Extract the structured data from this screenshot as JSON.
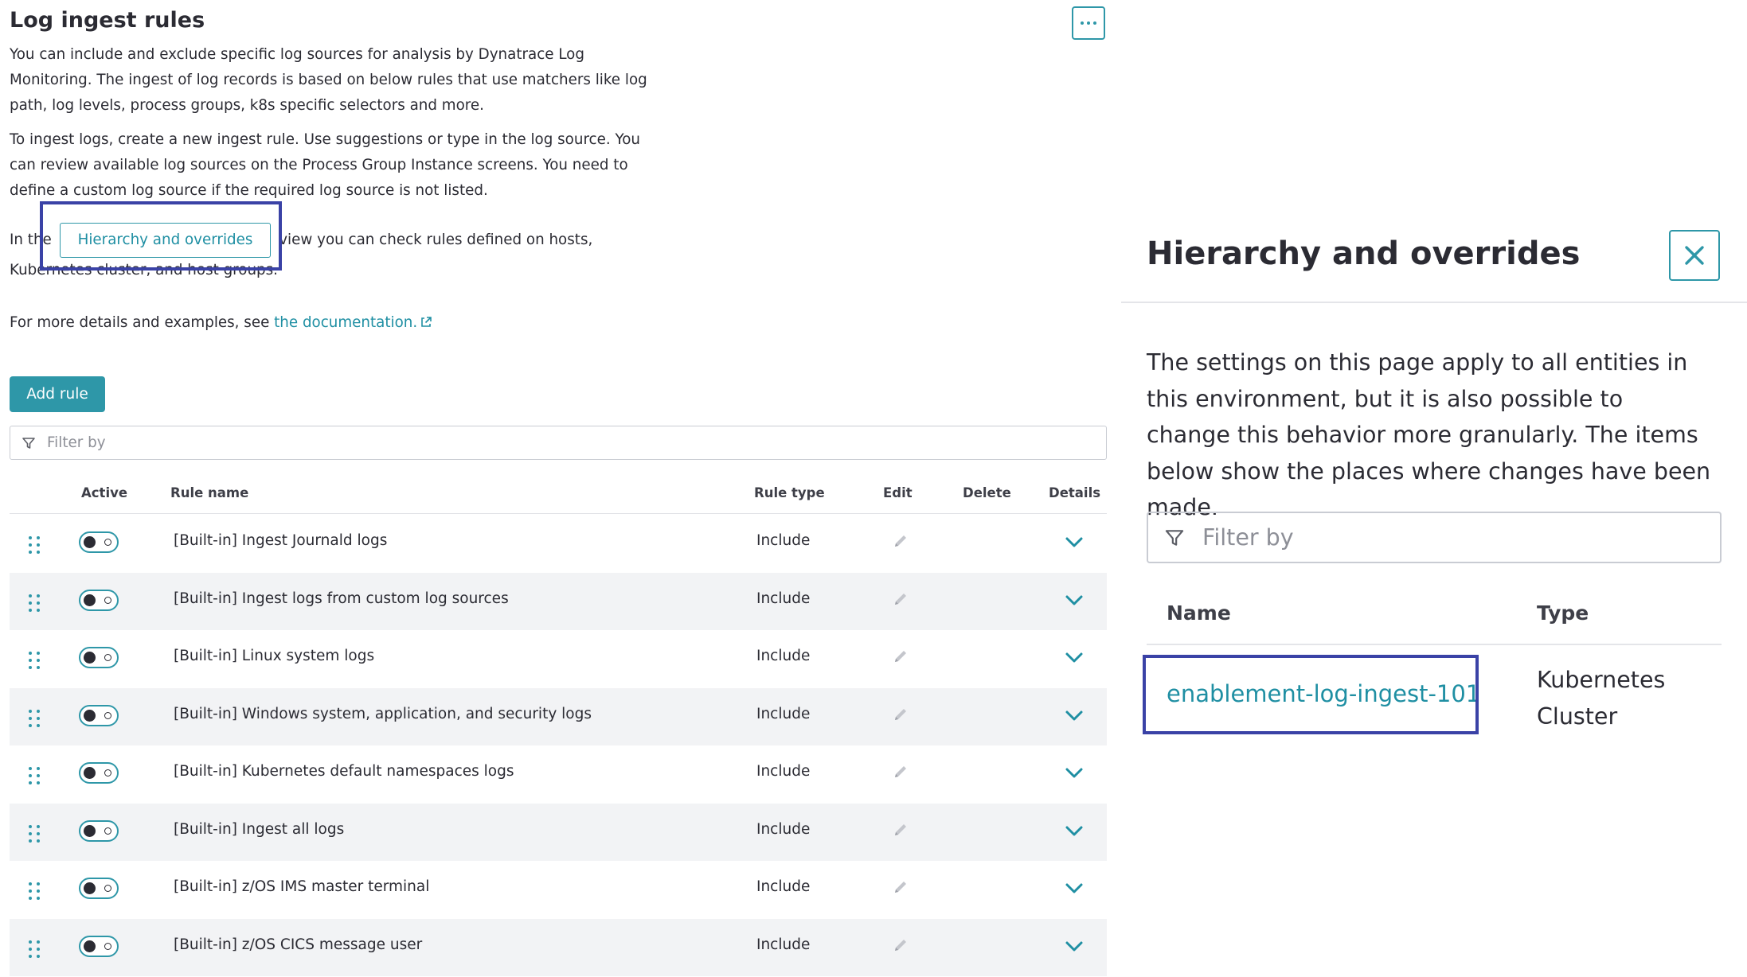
{
  "left": {
    "title": "Log ingest rules",
    "intro_1": "You can include and exclude specific log sources for analysis by Dynatrace Log Monitoring. The ingest of log records is based on below rules that use matchers like log path, log levels, process groups, k8s specific selectors and more.",
    "intro_2": "To ingest logs, create a new ingest rule. Use suggestions or type in the log source. You can review available log sources on the Process Group Instance screens. You need to define a custom log source if the required log source is not listed.",
    "hierarchy_prefix": "In the",
    "hierarchy_button": "Hierarchy and overrides",
    "hierarchy_suffix": "view you can check rules defined on hosts, Kubernetes cluster, and host groups.",
    "doc_prefix": "For more details and examples, see",
    "doc_link": "the documentation.",
    "add_rule": "Add rule",
    "filter_placeholder": "Filter by",
    "columns": {
      "active": "Active",
      "rule_name": "Rule name",
      "rule_type": "Rule type",
      "edit": "Edit",
      "delete": "Delete",
      "details": "Details"
    },
    "rules": [
      {
        "name": "[Built-in] Ingest Journald logs",
        "type": "Include"
      },
      {
        "name": "[Built-in] Ingest logs from custom log sources",
        "type": "Include"
      },
      {
        "name": "[Built-in] Linux system logs",
        "type": "Include"
      },
      {
        "name": "[Built-in] Windows system, application, and security logs",
        "type": "Include"
      },
      {
        "name": "[Built-in] Kubernetes default namespaces logs",
        "type": "Include"
      },
      {
        "name": "[Built-in] Ingest all logs",
        "type": "Include"
      },
      {
        "name": "[Built-in] z/OS IMS master terminal",
        "type": "Include"
      },
      {
        "name": "[Built-in] z/OS CICS message user",
        "type": "Include"
      }
    ]
  },
  "panel": {
    "title": "Hierarchy and overrides",
    "description": "The settings on this page apply to all entities in this environment, but it is also possible to change this behavior more granularly. The items below show the places where changes have been made.",
    "filter_placeholder": "Filter by",
    "col_name": "Name",
    "col_type": "Type",
    "entity_name": "enablement-log-ingest-101",
    "entity_type": "Kubernetes Cluster"
  },
  "colors": {
    "accent": "#2e97a8",
    "link": "#1f8fa3",
    "highlight": "#3a42a6",
    "text": "#2b2b33"
  },
  "icons": [
    "more-icon",
    "filter-icon",
    "drag-handle-icon",
    "pencil-icon",
    "chevron-down-icon",
    "external-link-icon",
    "close-icon"
  ]
}
